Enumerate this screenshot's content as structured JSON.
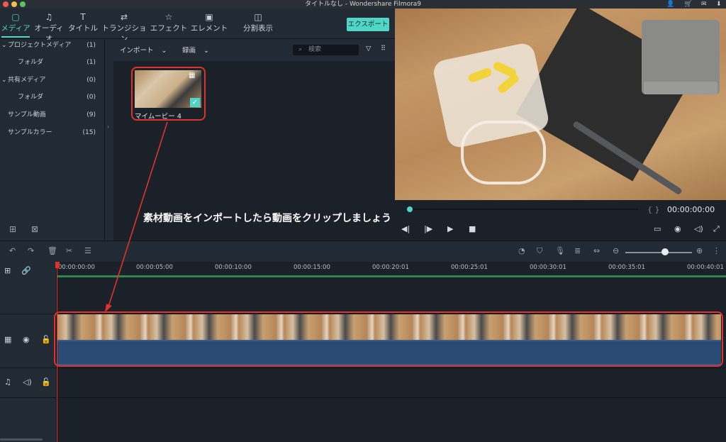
{
  "window": {
    "title": "タイトルなし - Wondershare Filmora9"
  },
  "tabs": [
    {
      "label": "メディア",
      "icon": "folder-icon"
    },
    {
      "label": "オーディオ",
      "icon": "music-note-icon"
    },
    {
      "label": "タイトル",
      "icon": "title-text-icon"
    },
    {
      "label": "トランジション",
      "icon": "transition-icon"
    },
    {
      "label": "エフェクト",
      "icon": "effect-star-icon"
    },
    {
      "label": "エレメント",
      "icon": "image-icon"
    },
    {
      "label": "分割表示",
      "icon": "split-screen-icon"
    }
  ],
  "export_label": "エクスポート",
  "sidebar": {
    "items": [
      {
        "label": "プロジェクトメディア",
        "count": "(1)"
      },
      {
        "label": "フォルダ",
        "count": "(1)"
      },
      {
        "label": "共有メディア",
        "count": "(0)"
      },
      {
        "label": "フォルダ",
        "count": "(0)"
      },
      {
        "label": "サンプル動画",
        "count": "(9)"
      },
      {
        "label": "サンプルカラー",
        "count": "(15)"
      }
    ]
  },
  "media_toolbar": {
    "import_label": "インポート",
    "record_label": "録画",
    "search_placeholder": "検索"
  },
  "clip": {
    "name": "マイムービー 4"
  },
  "caption": "素材動画をインポートしたら動画をクリップしましょう",
  "preview": {
    "timecode": "00:00:00:00"
  },
  "timeline": {
    "ticks": [
      "00:00:00:00",
      "00:00:05:00",
      "00:00:10:00",
      "00:00:15:00",
      "00:00:20:01",
      "00:00:25:01",
      "00:00:30:01",
      "00:00:35:01",
      "00:00:40:01"
    ]
  },
  "colors": {
    "accent": "#4fd6c6",
    "annotation": "#e0322c",
    "audio_track": "#2b4a73"
  }
}
